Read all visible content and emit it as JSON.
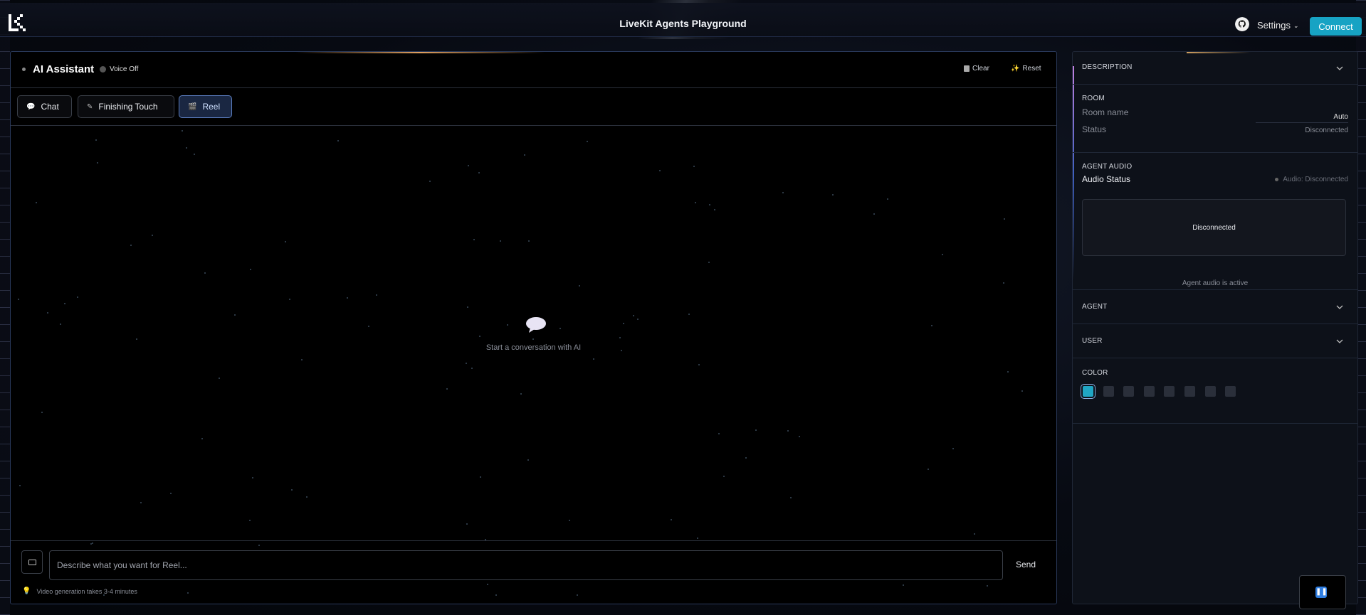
{
  "header": {
    "title": "LiveKit Agents Playground",
    "settings_label": "Settings",
    "connect_label": "Connect"
  },
  "main": {
    "assistant_name": "AI Assistant",
    "voice_status": "Voice Off",
    "clear_label": "Clear",
    "reset_label": "Reset",
    "tabs": [
      {
        "label": "Chat",
        "icon": "chat-bubble-icon"
      },
      {
        "label": "Finishing Touch",
        "icon": "brush-icon"
      },
      {
        "label": "Reel",
        "icon": "film-icon",
        "active": true
      }
    ],
    "empty_text": "Start a conversation with AI",
    "input_placeholder": "Describe what you want for Reel...",
    "send_label": "Send",
    "hint": "Video generation takes 3-4 minutes"
  },
  "side": {
    "description_title": "DESCRIPTION",
    "room_title": "ROOM",
    "room_name_label": "Room name",
    "room_name_value": "Auto",
    "status_label": "Status",
    "status_value": "Disconnected",
    "agent_audio_title": "AGENT AUDIO",
    "audio_status_label": "Audio Status",
    "audio_status_value": "Audio: Disconnected",
    "audio_box_text": "Disconnected",
    "audio_active_text": "Agent audio is active",
    "agent_title": "AGENT",
    "user_title": "USER",
    "color_title": "COLOR",
    "colors": [
      "#20a6c4",
      "#2a2f3a",
      "#2a2f3a",
      "#2a2f3a",
      "#2a2f3a",
      "#2a2f3a",
      "#2a2f3a",
      "#2a2f3a"
    ]
  }
}
